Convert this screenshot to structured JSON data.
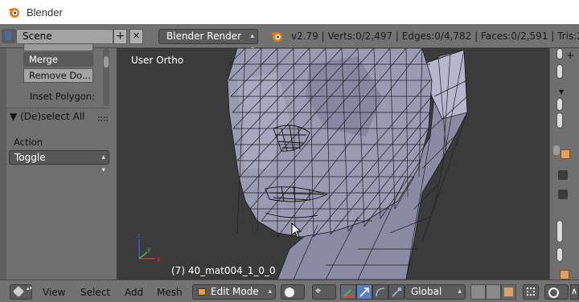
{
  "window": {
    "title": "Blender"
  },
  "info_header": {
    "scene_name": "Scene",
    "add_icon": "+",
    "remove_icon": "✕",
    "render_engine": "Blender Render",
    "stats": "v2.79 | Verts:0/2,497 | Edges:0/4,782 | Faces:0/2,591 | Tris:2,"
  },
  "tool_shelf": {
    "buttons": [
      "Merge",
      "Remove Do..."
    ],
    "inset_label": "Inset Polygon:",
    "panel_title": "(De)select All",
    "action_label": "Action",
    "action_value": "Toggle"
  },
  "viewport": {
    "view_label": "User Ortho",
    "object_label": "(7) 40_mat004_1_0_0",
    "axes": {
      "x": "x",
      "y": "y",
      "z": "z"
    }
  },
  "bottom_header": {
    "menus": [
      "View",
      "Select",
      "Add",
      "Mesh"
    ],
    "mode": "Edit Mode",
    "pivot_glyph": "⌖",
    "orientation": "Global",
    "snap_glyph": "∧"
  },
  "icons": {
    "window_logo": "blender-logo-icon",
    "editor_type": "info-editor-icon",
    "view3d_editor": "view3d-editor-icon",
    "shading": "solid-shading-icon",
    "pivot": "pivot-point-icon",
    "manipulators": [
      "manipulator-toggle-icon",
      "translate-icon",
      "rotate-icon",
      "scale-icon"
    ],
    "select_modes": [
      "vertex-select-icon",
      "edge-select-icon",
      "face-select-icon"
    ],
    "occlusion": "limit-selection-icon",
    "proportional": "proportional-edit-icon",
    "cursor": "mouse-cursor-icon"
  },
  "colors": {
    "header_bg": "#727272",
    "panel_bg": "#6f6f6f",
    "viewport_bg": "#3b3b3b",
    "mesh_face": "#9a9ab2",
    "wire": "#1a1a1a",
    "active_manip": "#5680c2",
    "blender_orange": "#e87d0d"
  }
}
